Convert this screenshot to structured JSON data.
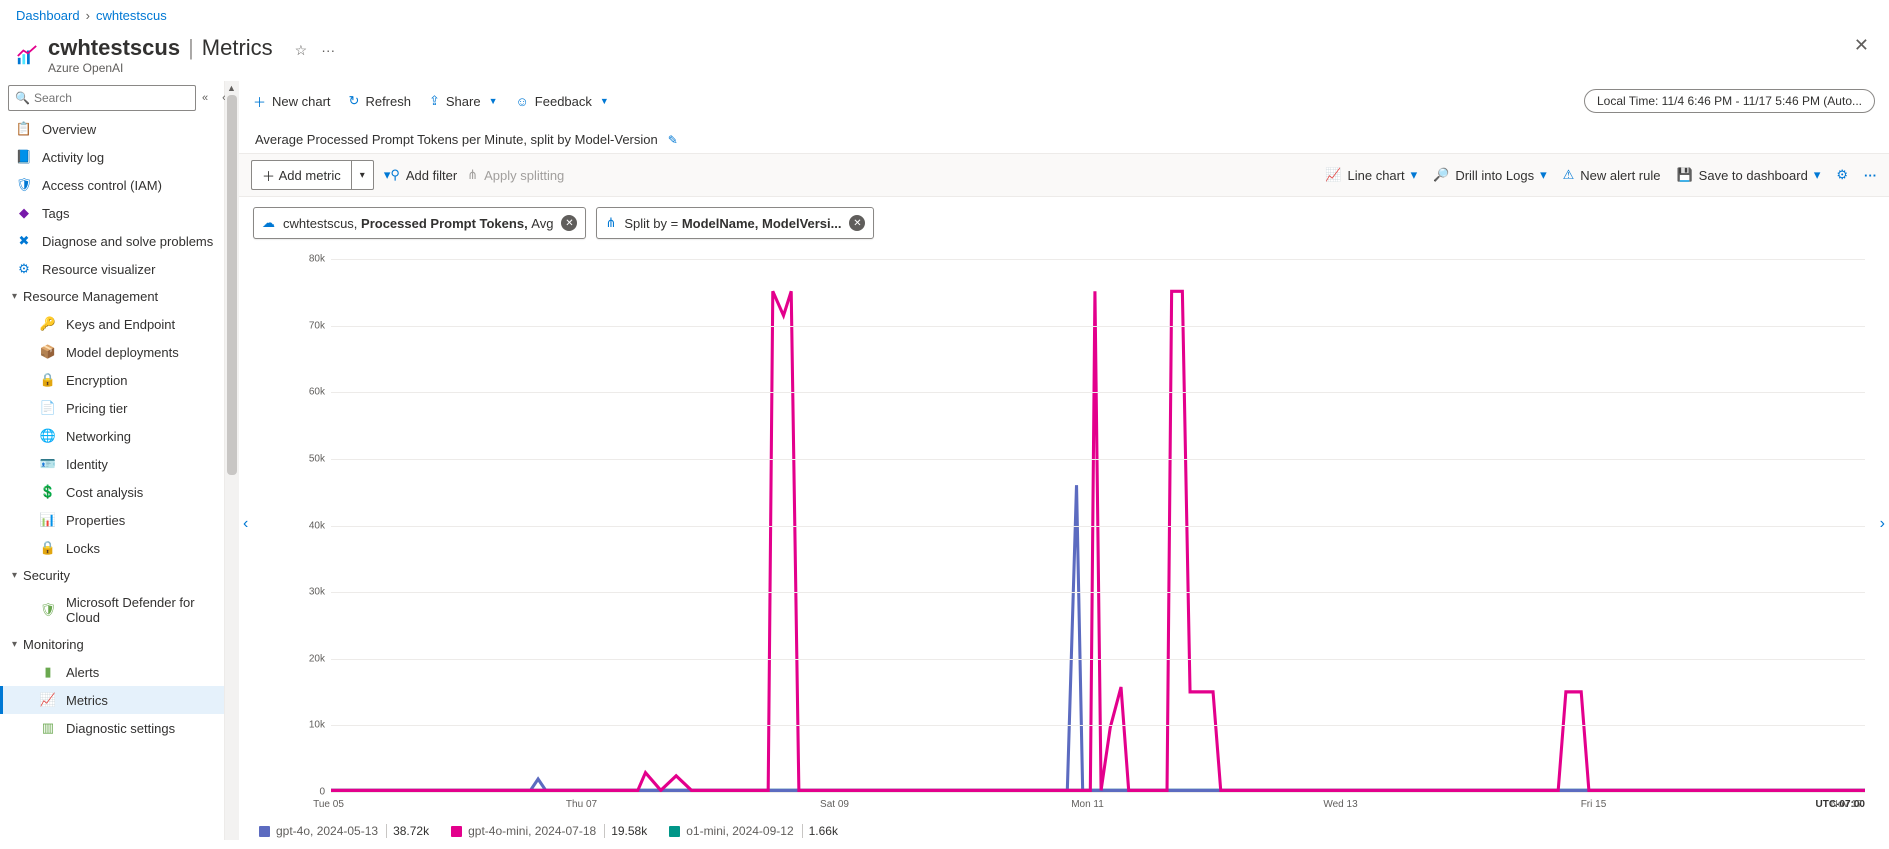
{
  "breadcrumb": {
    "dashboard": "Dashboard",
    "resource": "cwhtestscus"
  },
  "header": {
    "resource_name": "cwhtestscus",
    "divider": "|",
    "page": "Metrics",
    "subtitle": "Azure OpenAI",
    "star": "☆",
    "more": "···"
  },
  "search": {
    "placeholder": "Search"
  },
  "sidebar": {
    "top": [
      {
        "icon": "📋",
        "color": "#0078d4",
        "label": "Overview"
      },
      {
        "icon": "📘",
        "color": "#0078d4",
        "label": "Activity log"
      },
      {
        "icon": "🛡",
        "color": "#0078d4",
        "label": "Access control (IAM)"
      },
      {
        "icon": "◆",
        "color": "#7719aa",
        "label": "Tags"
      },
      {
        "icon": "✖",
        "color": "#0078d4",
        "label": "Diagnose and solve problems"
      },
      {
        "icon": "⚙",
        "color": "#0078d4",
        "label": "Resource visualizer"
      }
    ],
    "group_resource": "Resource Management",
    "resource_items": [
      {
        "icon": "🔑",
        "color": "#f2c811",
        "label": "Keys and Endpoint"
      },
      {
        "icon": "📦",
        "color": "#0078d4",
        "label": "Model deployments"
      },
      {
        "icon": "🔒",
        "color": "#d67f3c",
        "label": "Encryption"
      },
      {
        "icon": "📄",
        "color": "#6aa84f",
        "label": "Pricing tier"
      },
      {
        "icon": "🌐",
        "color": "#0078d4",
        "label": "Networking"
      },
      {
        "icon": "🪪",
        "color": "#0078d4",
        "label": "Identity"
      },
      {
        "icon": "💲",
        "color": "#6aa84f",
        "label": "Cost analysis"
      },
      {
        "icon": "📊",
        "color": "#0078d4",
        "label": "Properties"
      },
      {
        "icon": "🔒",
        "color": "#0078d4",
        "label": "Locks"
      }
    ],
    "group_security": "Security",
    "security_items": [
      {
        "icon": "🛡",
        "color": "#6aa84f",
        "label": "Microsoft Defender for Cloud"
      }
    ],
    "group_monitoring": "Monitoring",
    "monitoring_items": [
      {
        "icon": "▮",
        "color": "#6aa84f",
        "label": "Alerts"
      },
      {
        "icon": "📈",
        "color": "#0078d4",
        "label": "Metrics",
        "selected": true
      },
      {
        "icon": "▥",
        "color": "#6aa84f",
        "label": "Diagnostic settings"
      }
    ]
  },
  "toolbar": {
    "new_chart": "New chart",
    "refresh": "Refresh",
    "share": "Share",
    "feedback": "Feedback",
    "time_range": "Local Time: 11/4 6:46 PM - 11/17 5:46 PM (Auto..."
  },
  "chart_header": {
    "title": "Average Processed Prompt Tokens per Minute, split by Model-Version"
  },
  "metric_bar": {
    "add_metric": "Add metric",
    "add_filter": "Add filter",
    "apply_splitting": "Apply splitting",
    "line_chart": "Line chart",
    "drill_logs": "Drill into Logs",
    "new_alert": "New alert rule",
    "save_dashboard": "Save to dashboard"
  },
  "pills": {
    "metric_prefix": "cwhtestscus, ",
    "metric_bold": "Processed Prompt Tokens, ",
    "metric_suffix": "Avg",
    "split_prefix": "Split by = ",
    "split_bold": "ModelName, ModelVersi..."
  },
  "chart_data": {
    "type": "line",
    "ylim": [
      0,
      80000
    ],
    "yticks": [
      0,
      10000,
      20000,
      30000,
      40000,
      50000,
      60000,
      70000,
      80000
    ],
    "ytick_labels": [
      "0",
      "10k",
      "20k",
      "30k",
      "40k",
      "50k",
      "60k",
      "70k",
      "80k"
    ],
    "x_categories": [
      "Tue 05",
      "Thu 07",
      "Sat 09",
      "Mon 11",
      "Wed 13",
      "Fri 15",
      "Nov 17"
    ],
    "timezone": "UTC-07:00",
    "series": [
      {
        "name": "gpt-4o, 2024-05-13",
        "color": "#5c6bc0",
        "summary": "38.72k"
      },
      {
        "name": "gpt-4o-mini, 2024-07-18",
        "color": "#e3008c",
        "summary": "19.58k"
      },
      {
        "name": "o1-mini, 2024-09-12",
        "color": "#009688",
        "summary": "1.66k"
      }
    ]
  }
}
